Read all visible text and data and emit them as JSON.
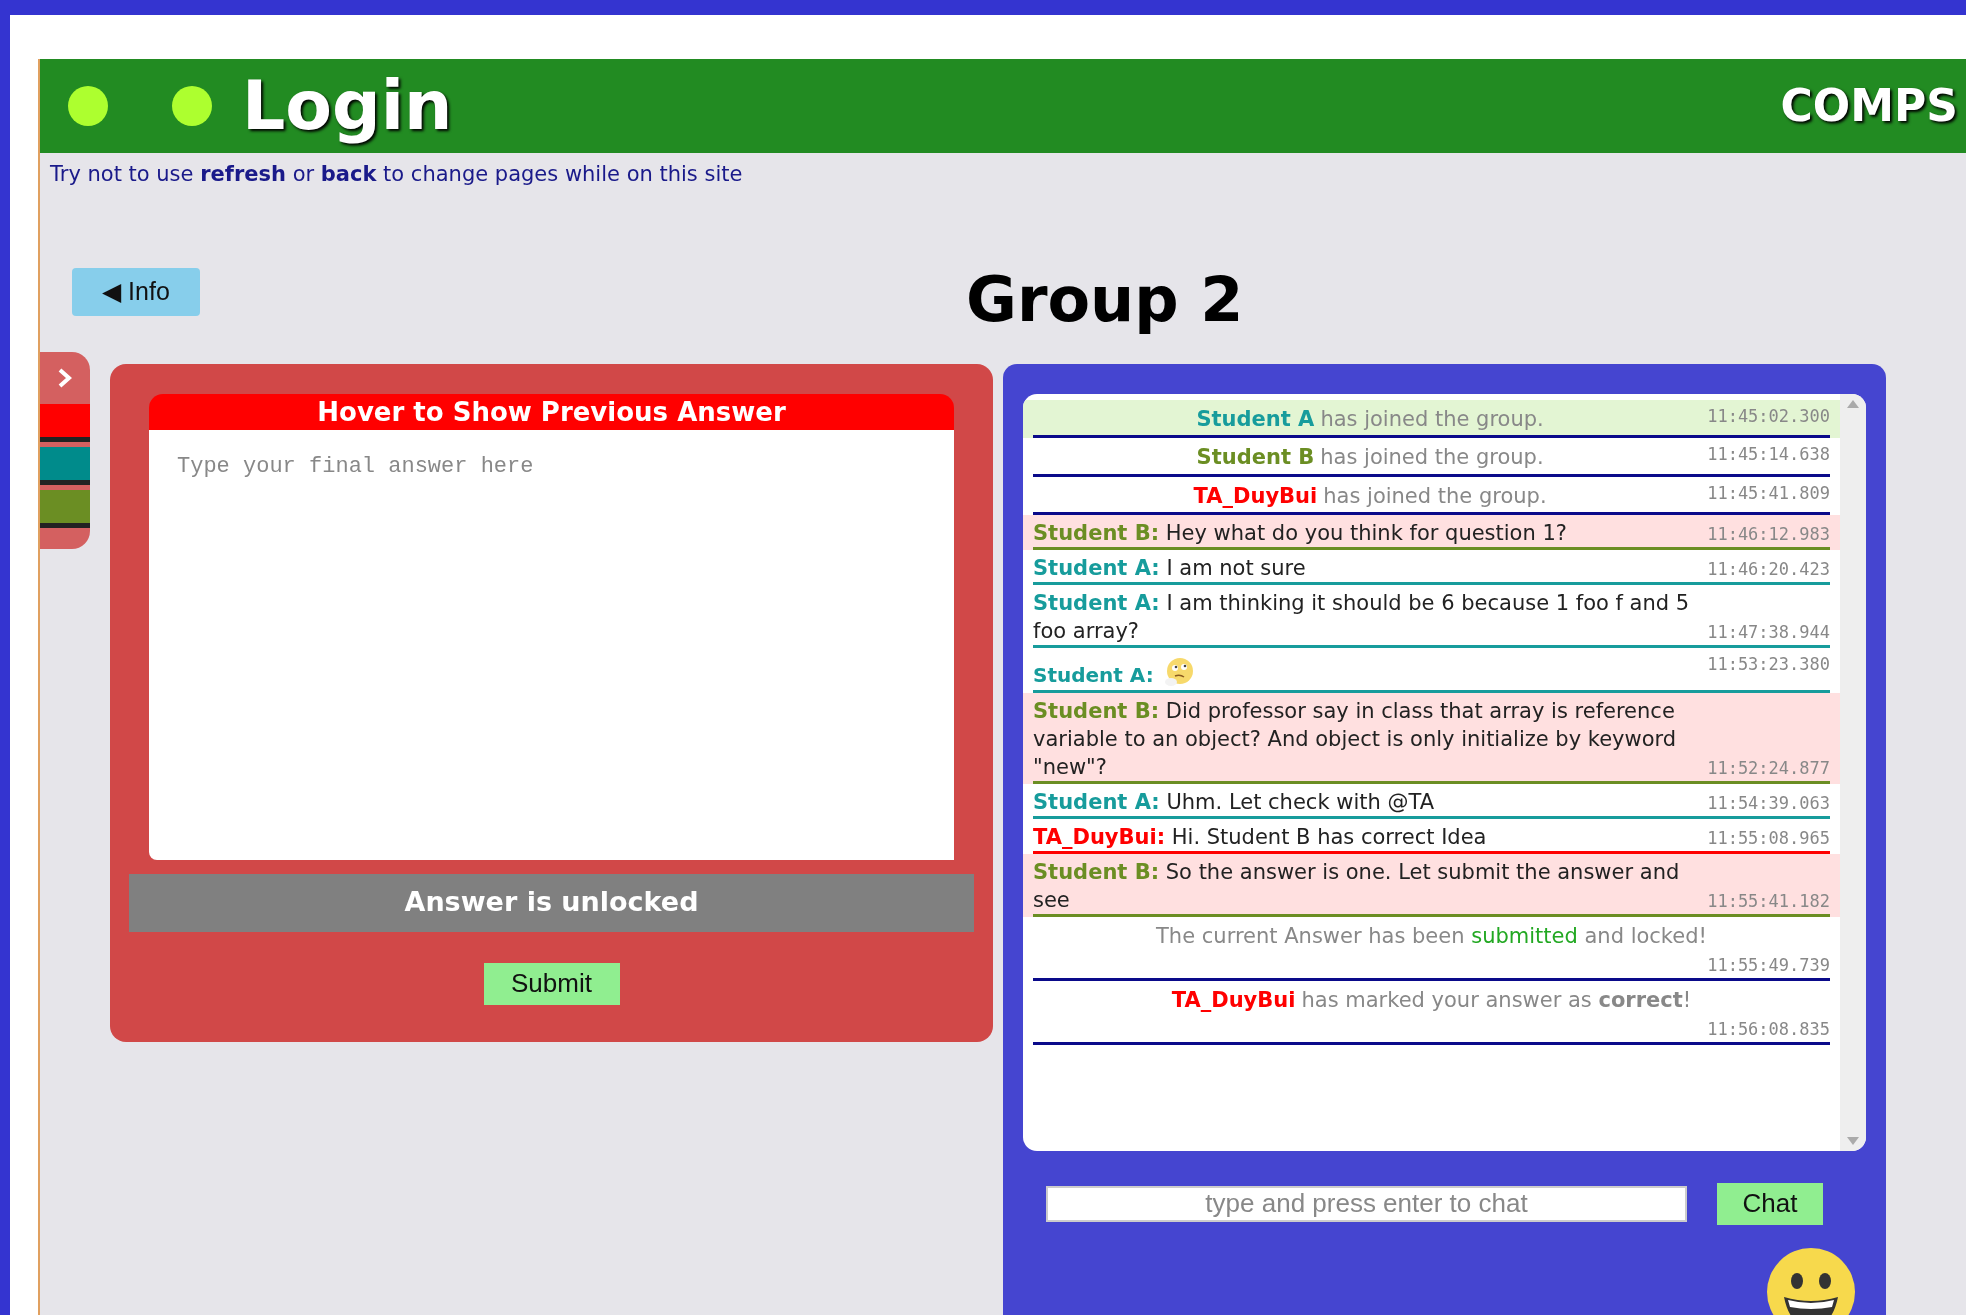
{
  "header": {
    "title": "Login",
    "brand": "COMPS"
  },
  "notice": "Try not to use **refresh** or **back** to change pages while on this site",
  "info_button": "◀ Info",
  "group_title": "Group 2",
  "side_tabs": [
    {
      "color": "#ff0000"
    },
    {
      "color": "#008b8b"
    },
    {
      "color": "#6b8e23"
    }
  ],
  "answer_panel": {
    "header": "Hover to Show Previous Answer",
    "placeholder": "Type your final answer here",
    "status": "Answer is unlocked",
    "submit": "Submit"
  },
  "chat": {
    "messages": [
      {
        "kind": "join",
        "name": "Student A",
        "color": "#179c9c",
        "text": "has joined the group.",
        "time": "11:45:02.300",
        "highlighted": true
      },
      {
        "kind": "join",
        "name": "Student B",
        "color": "#6b8e23",
        "text": "has joined the group.",
        "time": "11:45:14.638",
        "highlighted": false
      },
      {
        "kind": "join",
        "name": "TA_DuyBui",
        "color": "#ff0000",
        "text": "has joined the group.",
        "time": "11:45:41.809",
        "highlighted": false
      },
      {
        "kind": "message",
        "name": "Student B:",
        "color": "#6b8e23",
        "text": "Hey what do you think for question 1?",
        "time": "11:46:12.983",
        "highlighted": true
      },
      {
        "kind": "message",
        "name": "Student A:",
        "color": "#179c9c",
        "text": "I am not sure",
        "time": "11:46:20.423",
        "highlighted": false
      },
      {
        "kind": "message",
        "name": "Student A:",
        "color": "#179c9c",
        "text": "I am thinking it should be 6 because 1 foo f and 5 foo array?",
        "time": "11:47:38.944",
        "highlighted": false
      },
      {
        "kind": "emoji",
        "name": "Student A:",
        "color": "#179c9c",
        "time": "11:53:23.380",
        "highlighted": false
      },
      {
        "kind": "message",
        "name": "Student B:",
        "color": "#6b8e23",
        "text": "Did professor say in class that array is reference variable to an object? And object is only initialize by keyword \"new\"?",
        "time": "11:52:24.877",
        "highlighted": true
      },
      {
        "kind": "message",
        "name": "Student A:",
        "color": "#179c9c",
        "text": "Uhm. Let check with @TA",
        "time": "11:54:39.063",
        "highlighted": false
      },
      {
        "kind": "message",
        "name": "TA_DuyBui:",
        "color": "#ff0000",
        "text": "Hi. Student B has correct Idea",
        "time": "11:55:08.965",
        "highlighted": false
      },
      {
        "kind": "message",
        "name": "Student B:",
        "color": "#6b8e23",
        "text": "So the answer is one. Let submit the answer and see",
        "time": "11:55:41.182",
        "highlighted": true
      },
      {
        "kind": "notice",
        "text": "The current Answer has been *submitted* and locked!",
        "time": "11:55:49.739",
        "highlighted": false
      },
      {
        "kind": "mark",
        "name": "TA_DuyBui",
        "color": "#ff0000",
        "text": "has marked your answer as **correct**!",
        "time": "11:56:08.835",
        "highlighted": false
      }
    ],
    "input_placeholder": "type and press enter to chat",
    "send": "Chat"
  }
}
